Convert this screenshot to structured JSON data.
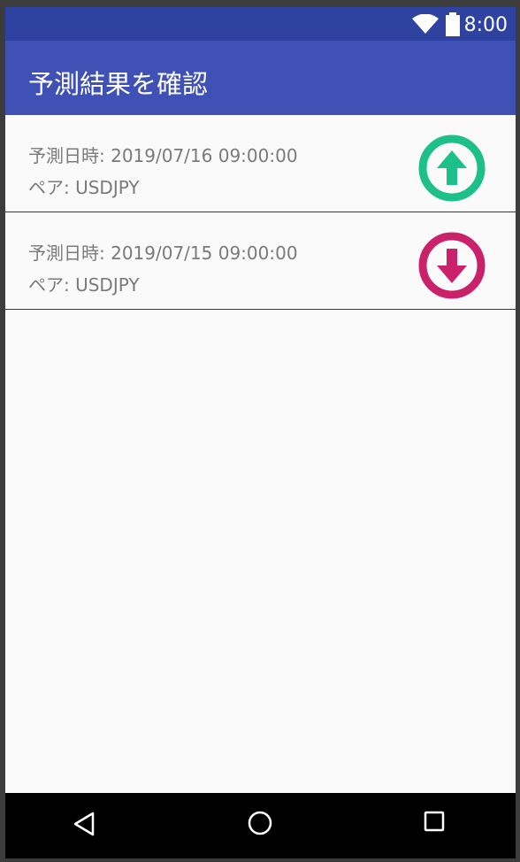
{
  "status_bar": {
    "time": "8:00",
    "icons": [
      "wifi-icon",
      "battery-icon"
    ]
  },
  "app_bar": {
    "title": "予測結果を確認"
  },
  "results": [
    {
      "date_text": "予測日時: 2019/07/16 09:00:00",
      "pair_text": "ペア: USDJPY",
      "direction": "up",
      "icon": "arrow-up-circle-icon",
      "color": "#1ec08a"
    },
    {
      "date_text": "予測日時: 2019/07/15 09:00:00",
      "pair_text": "ペア: USDJPY",
      "direction": "down",
      "icon": "arrow-down-circle-icon",
      "color": "#c9226b"
    }
  ],
  "nav_bar": {
    "icons": [
      "back-icon",
      "home-icon",
      "recent-apps-icon"
    ]
  },
  "colors": {
    "status_bar": "#2e42a0",
    "app_bar": "#3f51b5",
    "background": "#fafafa"
  }
}
